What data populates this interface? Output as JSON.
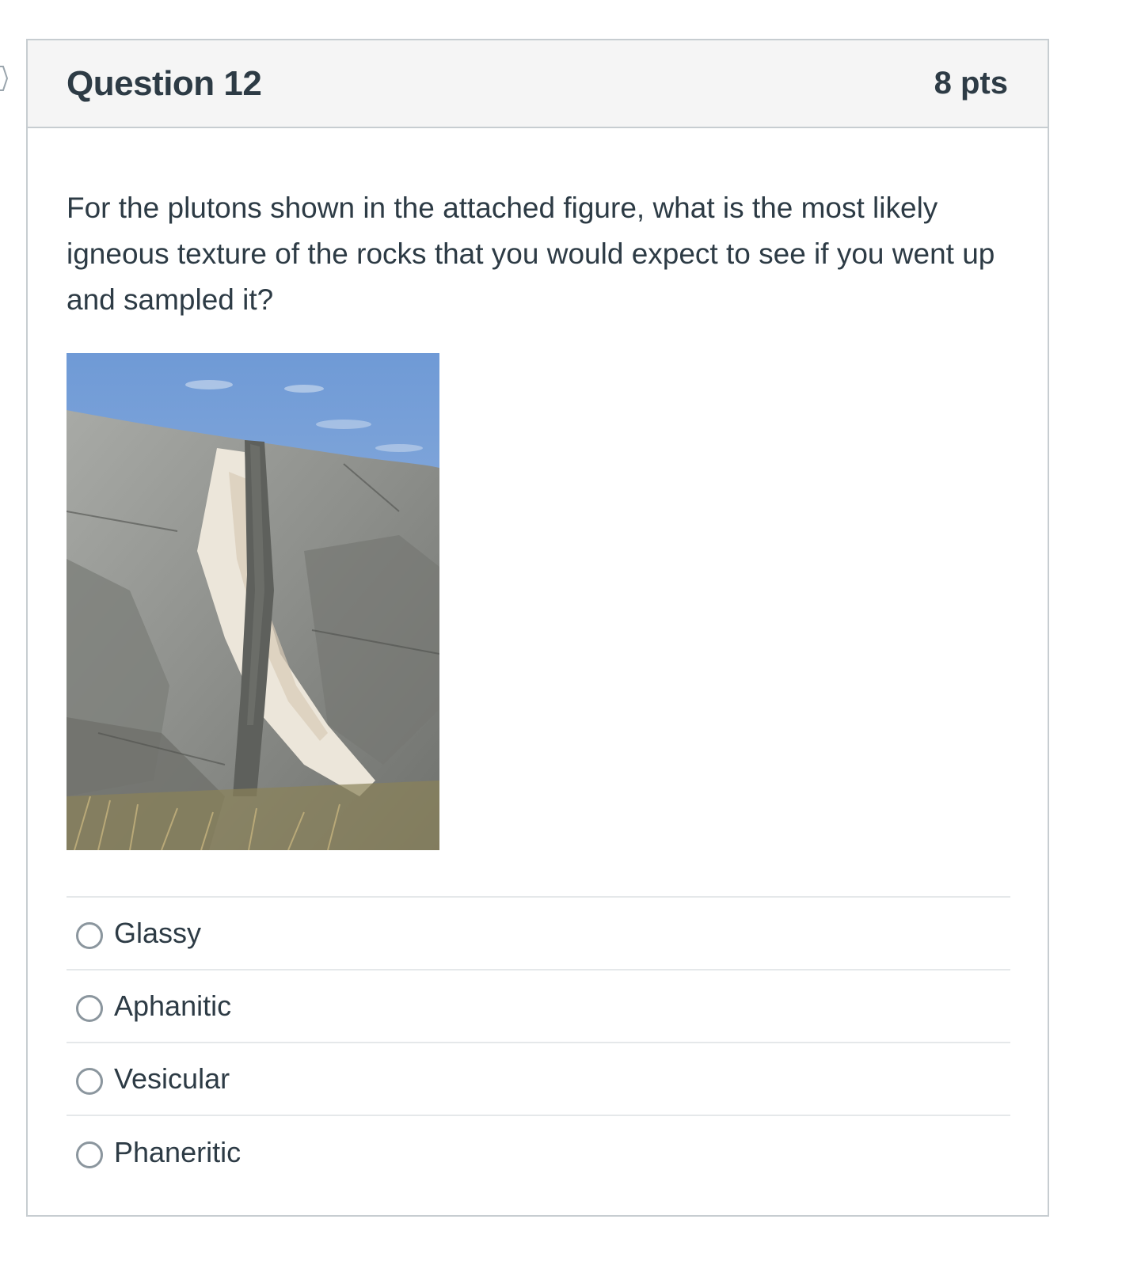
{
  "question": {
    "title": "Question 12",
    "points": "8 pts",
    "text": "For the plutons shown in the attached figure, what is the most likely igneous texture of the rocks that you would expect to see if you went up and sampled it?",
    "figure_icon": "rock-outcrop-photo",
    "answers": [
      {
        "label": "Glassy",
        "selected": false
      },
      {
        "label": "Aphanitic",
        "selected": false
      },
      {
        "label": "Vesicular",
        "selected": false
      },
      {
        "label": "Phaneritic",
        "selected": false
      }
    ]
  },
  "colors": {
    "text": "#2d3b45",
    "border": "#c7cdd1",
    "header_bg": "#f5f5f5",
    "radio": "#8b969e"
  }
}
